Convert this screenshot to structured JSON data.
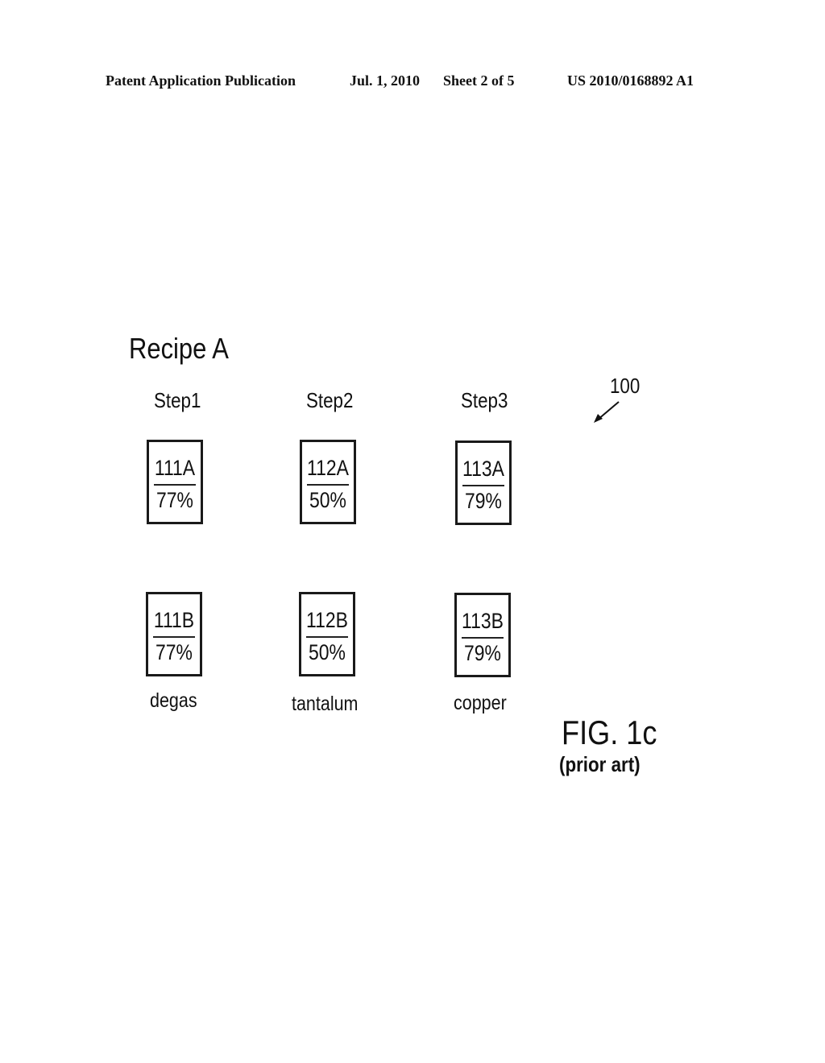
{
  "header": {
    "publication": "Patent Application Publication",
    "date": "Jul. 1, 2010",
    "sheet": "Sheet 2 of 5",
    "number": "US 2010/0168892 A1"
  },
  "figure": {
    "recipe_title": "Recipe A",
    "reference_numeral": "100",
    "label": "FIG. 1c",
    "sublabel": "(prior art)",
    "steps": [
      {
        "label": "Step1",
        "material": "degas",
        "chambers": [
          {
            "id": "111A",
            "value": "77%"
          },
          {
            "id": "111B",
            "value": "77%"
          }
        ]
      },
      {
        "label": "Step2",
        "material": "tantalum",
        "chambers": [
          {
            "id": "112A",
            "value": "50%"
          },
          {
            "id": "112B",
            "value": "50%"
          }
        ]
      },
      {
        "label": "Step3",
        "material": "copper",
        "chambers": [
          {
            "id": "113A",
            "value": "79%"
          },
          {
            "id": "113B",
            "value": "79%"
          }
        ]
      }
    ]
  }
}
